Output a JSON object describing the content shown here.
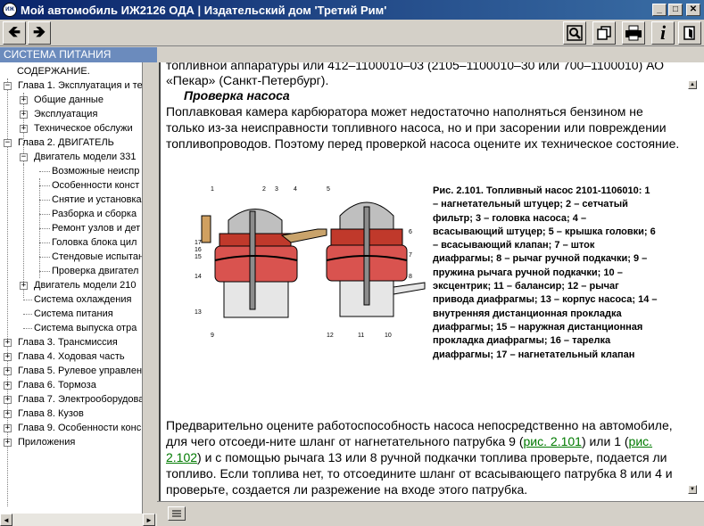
{
  "window": {
    "title": "Мой автомобиль ИЖ2126 ОДА | Издательский дом 'Третий Рим'",
    "app_icon_text": "ИЖ",
    "buttons": {
      "minimize": "_",
      "maximize": "□",
      "close": "✕"
    }
  },
  "toolbar": {
    "back_icon": "arrow-left-icon",
    "forward_icon": "arrow-right-icon",
    "search_icon": "magnifier-icon",
    "copy_icon": "pages-icon",
    "print_icon": "printer-icon",
    "info_icon": "info-icon",
    "exit_icon": "exit-door-icon"
  },
  "section_title": "СИСТЕМА ПИТАНИЯ",
  "tree": [
    {
      "label": "СОДЕРЖАНИЕ."
    },
    {
      "label": "Глава 1. Эксплуатация и те"
    },
    {
      "label": "Общие данные"
    },
    {
      "label": "Эксплуатация"
    },
    {
      "label": "Техническое обслужи"
    },
    {
      "label": "Глава 2. ДВИГАТЕЛЬ"
    },
    {
      "label": "Двигатель модели 331"
    },
    {
      "label": "Возможные неиспр"
    },
    {
      "label": "Особенности конст"
    },
    {
      "label": "Снятие и установка"
    },
    {
      "label": "Разборка и сборка"
    },
    {
      "label": "Ремонт узлов и дет"
    },
    {
      "label": "Головка блока цил"
    },
    {
      "label": "Стендовые испытан"
    },
    {
      "label": "Проверка двигател"
    },
    {
      "label": "Двигатель модели 210"
    },
    {
      "label": "Система охлаждения"
    },
    {
      "label": "Система питания"
    },
    {
      "label": "Система выпуска отра"
    },
    {
      "label": "Глава 3. Трансмиссия"
    },
    {
      "label": "Глава 4. Ходовая часть"
    },
    {
      "label": "Глава 5. Рулевое управлен"
    },
    {
      "label": "Глава 6. Тормоза"
    },
    {
      "label": "Глава 7. Электрооборудова"
    },
    {
      "label": "Глава 8. Кузов"
    },
    {
      "label": "Глава 9. Особенности конс"
    },
    {
      "label": "Приложения"
    }
  ],
  "content": {
    "top_line": "топливной аппаратуры или 412–1100010–03 (2105–1100010–30 или 700–1100010) АО",
    "top_line2": "«Пекар» (Санкт-Петербург).",
    "heading": "Проверка насоса",
    "para1": "Поплавковая камера карбюратора может недостаточно наполняться бензином не только из-за неисправности топливного насоса, но и при засорении или повреждении топливопроводов. Поэтому перед проверкой насоса оцените их техническое состояние.",
    "caption": "Рис. 2.101. Топливный насос 2101-1106010: 1 – нагнетательный штуцер; 2 – сетчатый фильтр; 3 – головка насоса; 4 – всасывающий штуцер; 5 – крышка головки; 6 – всасывающий клапан; 7 – шток диафрагмы; 8 – рычаг ручной подкачки; 9 – пружина рычага ручной подкачки; 10 – эксцентрик; 11 – балансир; 12 – рычаг привода диафрагмы; 13 – корпус насоса; 14 – внутренняя дистанционная прокладка диафрагмы; 15 – наружная дистанционная прокладка диафрагмы; 16 – тарелка диафрагмы; 17 – нагнетательный клапан",
    "para2_a": "Предварительно оцените работоспособность насоса непосредственно на автомобиле, для чего отсоеди-ните шланг от нагнетательного патрубка 9 (",
    "link1": "рис. 2.101",
    "para2_b": ") или 1 (",
    "link2": "рис. 2.102",
    "para2_c": ") и с помощью рычага 13 или 8 ручной подкачки топлива проверьте, подается ли топливо. Если топлива нет, то отсоедините шланг от всасывающего патрубка 8 или 4 и проверьте, создается ли разрежение на входе этого патрубка.",
    "figure_labels": [
      "1",
      "2",
      "3",
      "4",
      "5",
      "6",
      "7",
      "8",
      "9",
      "10",
      "11",
      "12",
      "13",
      "14",
      "15",
      "16",
      "17"
    ]
  },
  "colors": {
    "titlebar": "#0a246a",
    "section_bar": "#6b8bbd",
    "link": "#007a00"
  }
}
